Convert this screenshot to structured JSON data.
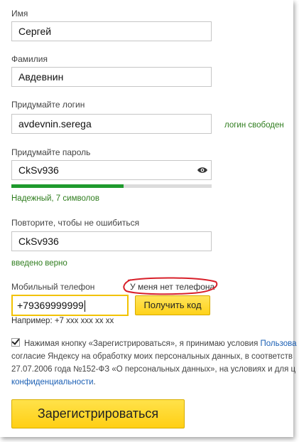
{
  "form": {
    "first_name": {
      "label": "Имя",
      "value": "Сергей"
    },
    "last_name": {
      "label": "Фамилия",
      "value": "Авдевнин"
    },
    "login": {
      "label": "Придумайте логин",
      "value": "avdevnin.serega",
      "status": "логин свободен"
    },
    "password": {
      "label": "Придумайте пароль",
      "value": "CkSv936",
      "strength_text": "Надежный, 7 символов",
      "strength": 0.56,
      "eye_icon": "eye-icon"
    },
    "password_repeat": {
      "label": "Повторите, чтобы не ошибиться",
      "value": "CkSv936",
      "status": "введено верно"
    },
    "phone": {
      "label": "Мобильный телефон",
      "value": "+79369999999",
      "no_phone_link": "У меня нет телефона",
      "get_code_button": "Получить код",
      "example": "Например: +7 xxx xxx xx xx"
    },
    "terms": {
      "line1_text": "Нажимая кнопку «Зарегистрироваться», я принимаю условия ",
      "line1_link": "Пользова",
      "line2": "согласие Яндексу на обработку моих персональных данных, в соответств",
      "line3_text": "27.07.2006 года №152-ФЗ «О персональных данных», на условиях и для ц",
      "line4_link": "конфиденциальности",
      "line4_tail": "."
    },
    "register_button": "Зарегистрироваться"
  },
  "colors": {
    "accent_yellow": "#ffd21a",
    "status_green": "#2f7d1e",
    "strength_green": "#1f9a2d",
    "annotation_red": "#d8202a",
    "link_blue": "#1a5fb4"
  }
}
